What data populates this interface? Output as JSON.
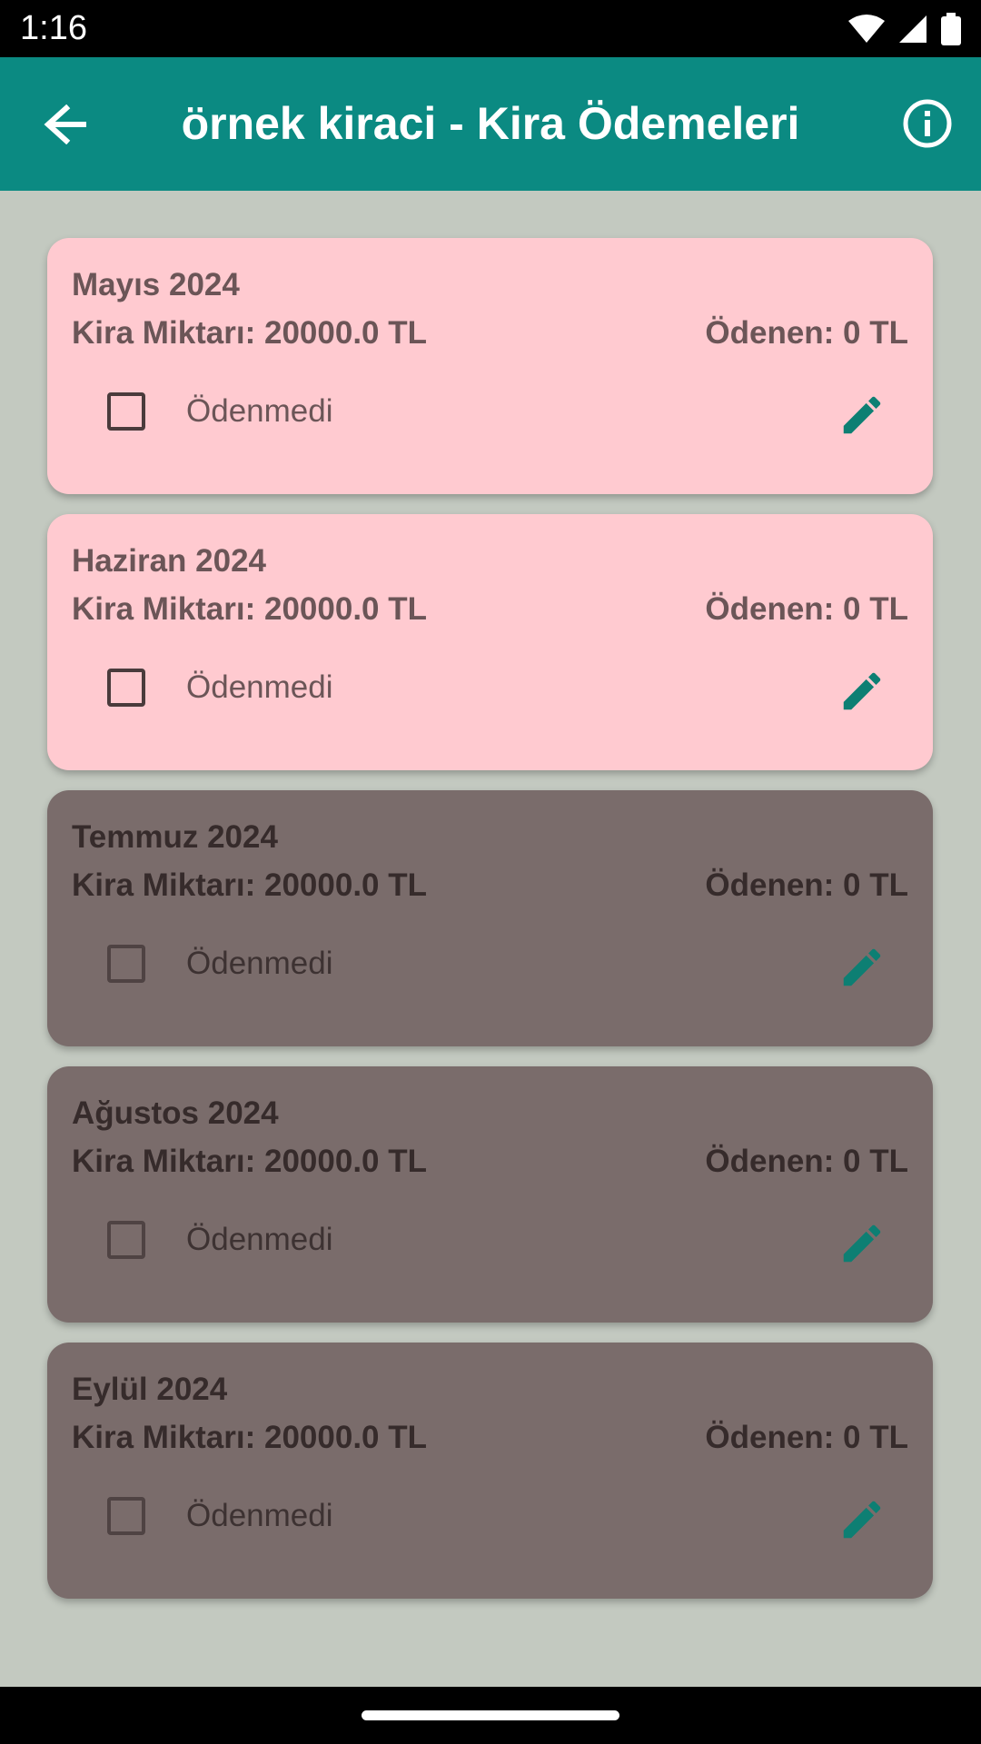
{
  "status_bar": {
    "time": "1:16"
  },
  "app_bar": {
    "title": "örnek kiraci - Kira Ödemeleri"
  },
  "colors": {
    "app_bar": "#0b8a82",
    "background": "#c3c9c0",
    "card_unpaid": "#ffcad0",
    "card_upcoming": "#7a6c6b",
    "edit_icon": "#0d7f73"
  },
  "payments": [
    {
      "month": "Mayıs 2024",
      "amount": "Kira Miktarı: 20000.0 TL",
      "paid": "Ödenen: 0 TL",
      "status": "Ödenmedi",
      "checked": false,
      "state": "unpaid"
    },
    {
      "month": "Haziran 2024",
      "amount": "Kira Miktarı: 20000.0 TL",
      "paid": "Ödenen: 0 TL",
      "status": "Ödenmedi",
      "checked": false,
      "state": "unpaid"
    },
    {
      "month": "Temmuz 2024",
      "amount": "Kira Miktarı: 20000.0 TL",
      "paid": "Ödenen: 0 TL",
      "status": "Ödenmedi",
      "checked": false,
      "state": "upcoming"
    },
    {
      "month": "Ağustos 2024",
      "amount": "Kira Miktarı: 20000.0 TL",
      "paid": "Ödenen: 0 TL",
      "status": "Ödenmedi",
      "checked": false,
      "state": "upcoming"
    },
    {
      "month": "Eylül 2024",
      "amount": "Kira Miktarı: 20000.0 TL",
      "paid": "Ödenen: 0 TL",
      "status": "Ödenmedi",
      "checked": false,
      "state": "upcoming"
    }
  ],
  "icons": {
    "back": "arrow-back-icon",
    "info": "info-icon",
    "edit": "pencil-icon",
    "wifi": "wifi-icon",
    "signal": "signal-icon",
    "battery": "battery-icon"
  }
}
